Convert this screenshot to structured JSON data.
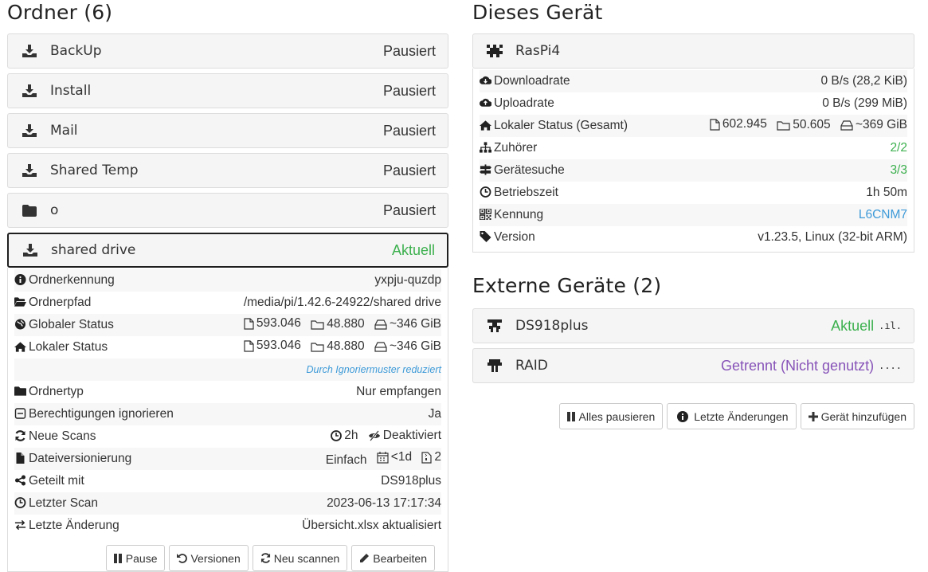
{
  "folders": {
    "heading": "Ordner (6)",
    "items": [
      {
        "name": "BackUp",
        "status": "Pausiert",
        "icon": "download-icon"
      },
      {
        "name": "Install",
        "status": "Pausiert",
        "icon": "download-icon"
      },
      {
        "name": "Mail",
        "status": "Pausiert",
        "icon": "download-icon"
      },
      {
        "name": "Shared Temp",
        "status": "Pausiert",
        "icon": "download-icon"
      },
      {
        "name": "o",
        "status": "Pausiert",
        "icon": "folder-icon"
      },
      {
        "name": "shared drive",
        "status": "Aktuell",
        "icon": "download-icon"
      }
    ],
    "details": {
      "folder_id_label": "Ordnerkennung",
      "folder_id": "yxpju-quzdp",
      "folder_path_label": "Ordnerpfad",
      "folder_path": "/media/pi/1.42.6-24922/shared drive",
      "global_status_label": "Globaler Status",
      "global_files": "593.046",
      "global_dirs": "48.880",
      "global_size": "~346 GiB",
      "local_status_label": "Lokaler Status",
      "local_files": "593.046",
      "local_dirs": "48.880",
      "local_size": "~346 GiB",
      "reduced_note": "Durch Ignoriermuster reduziert",
      "folder_type_label": "Ordnertyp",
      "folder_type": "Nur empfangen",
      "ignore_perms_label": "Berechtigungen ignorieren",
      "ignore_perms": "Ja",
      "rescans_label": "Neue Scans",
      "rescan_interval": "2h",
      "watcher": "Deaktiviert",
      "versioning_label": "Dateiversionierung",
      "versioning_type": "Einfach",
      "versioning_age": "<1d",
      "versioning_keep": "2",
      "shared_with_label": "Geteilt mit",
      "shared_with": "DS918plus",
      "last_scan_label": "Letzter Scan",
      "last_scan": "2023-06-13 17:17:34",
      "last_change_label": "Letzte Änderung",
      "last_change": "Übersicht.xlsx aktualisiert"
    },
    "buttons": {
      "pause": "Pause",
      "versions": "Versionen",
      "rescan": "Neu scannen",
      "edit": "Bearbeiten"
    }
  },
  "this_device": {
    "heading": "Dieses Gerät",
    "name": "RasPi4",
    "download_label": "Downloadrate",
    "download": "0 B/s (28,2 KiB)",
    "upload_label": "Uploadrate",
    "upload": "0 B/s (299 MiB)",
    "local_total_label": "Lokaler Status (Gesamt)",
    "local_files": "602.945",
    "local_dirs": "50.605",
    "local_size": "~369 GiB",
    "listeners_label": "Zuhörer",
    "listeners": "2/2",
    "discovery_label": "Gerätesuche",
    "discovery": "3/3",
    "uptime_label": "Betriebszeit",
    "uptime": "1h 50m",
    "id_label": "Kennung",
    "id": "L6CNM7",
    "version_label": "Version",
    "version": "v1.23.5, Linux (32-bit ARM)"
  },
  "remote_devices": {
    "heading": "Externe Geräte (2)",
    "items": [
      {
        "name": "DS918plus",
        "status": "Aktuell",
        "signal": ".ıl."
      },
      {
        "name": "RAID",
        "status": "Getrennt (Nicht genutzt)",
        "signal": "...."
      }
    ]
  },
  "actions": {
    "pause_all": "Alles pausieren",
    "recent_changes": "Letzte Änderungen",
    "add_device": "Gerät hinzufügen"
  },
  "colors": {
    "up_to_date": "#3cb04e",
    "disconnected": "#8753b8",
    "link": "#3d9ad8"
  }
}
